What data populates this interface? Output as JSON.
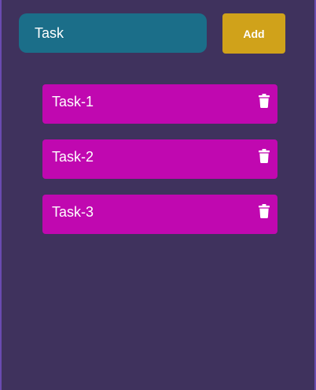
{
  "input": {
    "value": "Task",
    "placeholder": ""
  },
  "add_button": {
    "label": "Add"
  },
  "tasks": [
    {
      "label": "Task-1",
      "icon": "trash-icon"
    },
    {
      "label": "Task-2",
      "icon": "trash-icon"
    },
    {
      "label": "Task-3",
      "icon": "trash-icon"
    }
  ],
  "colors": {
    "background": "#3f325d",
    "input_bg": "#1b6e89",
    "button_bg": "#d0a21a",
    "task_bg": "#c008b0",
    "text": "#ffffff"
  }
}
